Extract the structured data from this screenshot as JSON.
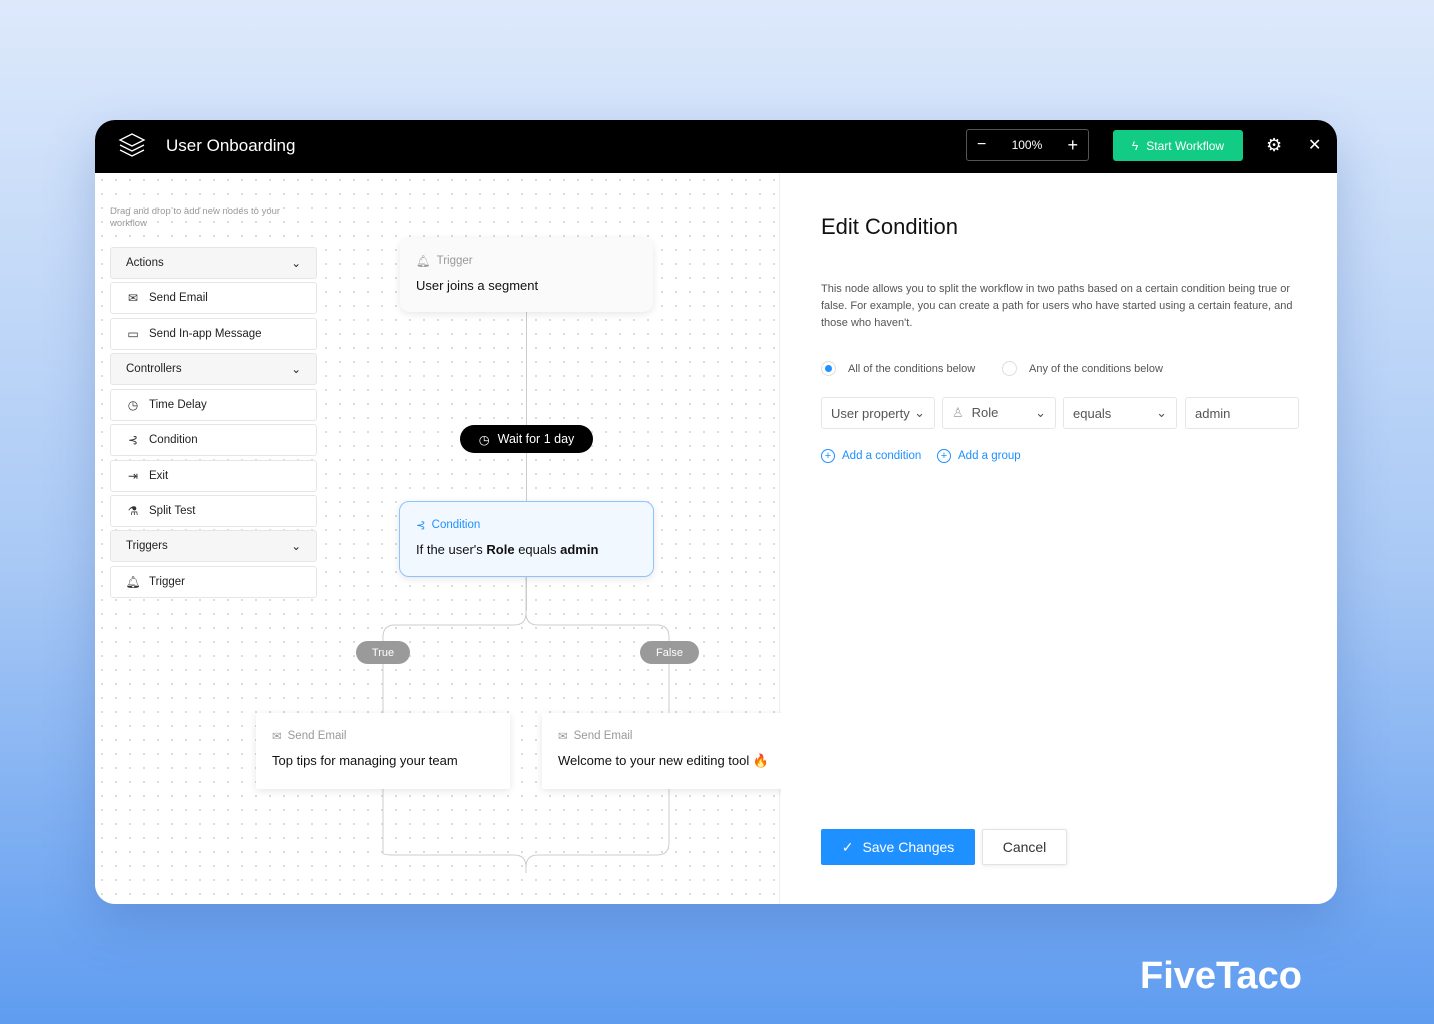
{
  "header": {
    "title": "User Onboarding",
    "zoom": "100%",
    "zoom_out": "−",
    "zoom_in": "+",
    "start_label": "Start Workflow",
    "accent": "#12cc85"
  },
  "palette": {
    "hint": "Drag and drop to add new nodes to your workflow",
    "items": [
      {
        "label": "Actions",
        "group": true
      },
      {
        "label": "Send Email",
        "icon": "mail-icon"
      },
      {
        "label": "Send In-app Message",
        "icon": "message-icon"
      },
      {
        "label": "Controllers",
        "group": true
      },
      {
        "label": "Time Delay",
        "icon": "clock-icon"
      },
      {
        "label": "Condition",
        "icon": "branch-icon"
      },
      {
        "label": "Exit",
        "icon": "exit-icon"
      },
      {
        "label": "Split Test",
        "icon": "flask-icon"
      },
      {
        "label": "Triggers",
        "group": true
      },
      {
        "label": "Trigger",
        "icon": "bell-icon"
      }
    ]
  },
  "flow": {
    "trigger": {
      "label": "Trigger",
      "text": "User joins a segment"
    },
    "wait": "Wait for 1 day",
    "condition": {
      "label": "Condition",
      "pre": "If the user's ",
      "field": "Role",
      "op": " equals ",
      "value": "admin"
    },
    "true_label": "True",
    "false_label": "False",
    "email1": {
      "label": "Send Email",
      "text": "Top tips for managing your team"
    },
    "email2": {
      "label": "Send Email",
      "text": "Welcome to your new editing tool 🔥"
    }
  },
  "panel": {
    "title": "Edit Condition",
    "description": "This node allows you to split the workflow in two paths based on a certain condition being true or false. For example, you can create a path for users who have started using a certain feature, and those who haven't.",
    "radio_all": "All of the conditions below",
    "radio_any": "Any of the conditions below",
    "selected": "all",
    "property": "User property",
    "field": "Role",
    "operator": "equals",
    "value": "admin",
    "add_condition": "Add a condition",
    "add_group": "Add a group",
    "save": "Save Changes",
    "cancel": "Cancel",
    "accent": "#1e90ff"
  },
  "brand": "FiveTaco"
}
